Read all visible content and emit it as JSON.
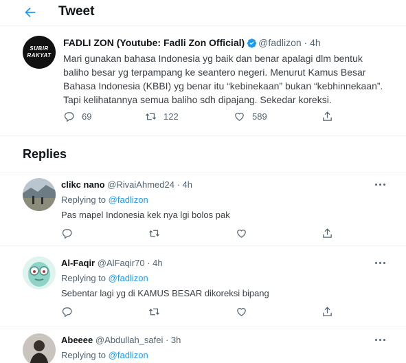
{
  "header": {
    "title": "Tweet",
    "back_icon": "arrow-left-icon"
  },
  "tweet": {
    "name": "FADLI ZON (Youtube: Fadli Zon Official)",
    "handle": "@fadlizon",
    "time": "· 4h",
    "avatar_text_top": "SUBIR",
    "avatar_text_bottom": "RAKYAT",
    "body": [
      "Mari gunakan bahasa Indonesia yg baik dan benar apalagi dlm bentuk",
      "baliho besar yg terpampang ke seantero negeri. Menurut Kamus Besar",
      "Bahasa Indonesia (KBBI) yg benar itu “kebinekaan” bukan “kebhinnekaan”.",
      "Tapi kelihatannya semua baliho sdh dipajang. Sekedar koreksi."
    ],
    "replies_count": "69",
    "retweets_count": "122",
    "likes_count": "589"
  },
  "replies_section": {
    "title": "Replies"
  },
  "replies": [
    {
      "name": "clikc nano",
      "handle": "@RivaiAhmed24",
      "time": "· 4h",
      "replying_label": "Replying to",
      "replying_to": "@fadlizon",
      "text": "Pas mapel Indonesia kek nya lgi bolos pak"
    },
    {
      "name": "Al-Faqir",
      "handle": "@AlFaqir70",
      "time": "· 4h",
      "replying_label": "Replying to",
      "replying_to": "@fadlizon",
      "text": "Sebentar lagi yg di KAMUS BESAR dikoreksi bipang"
    },
    {
      "name": "Abeeee",
      "handle": "@Abdullah_safei",
      "time": "· 3h",
      "replying_label": "Replying to",
      "replying_to": "@fadlizon",
      "text": ""
    }
  ],
  "colors": {
    "accent": "#1d9bf0",
    "muted": "#536471",
    "border": "#eff3f4"
  }
}
